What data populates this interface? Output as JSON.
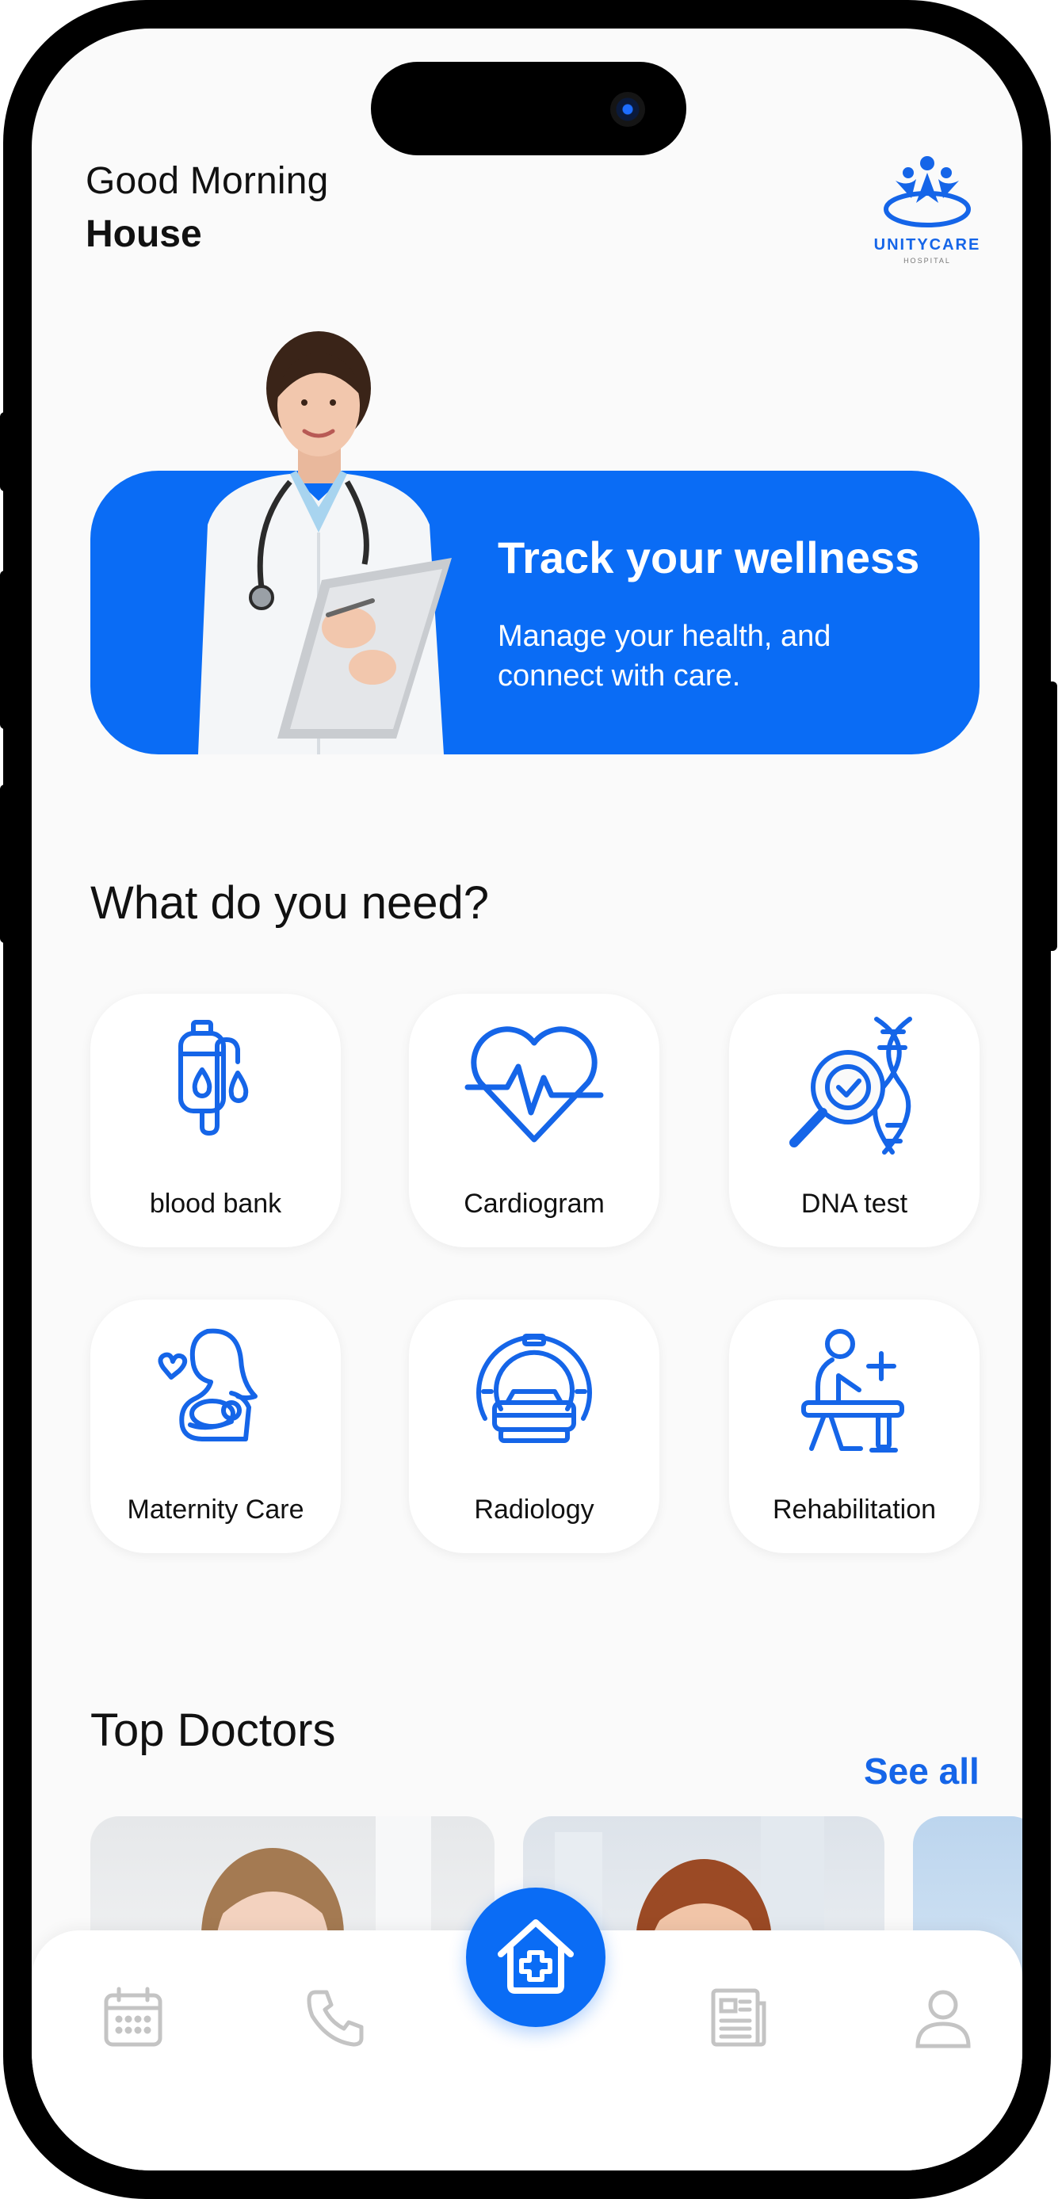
{
  "header": {
    "greeting": "Good Morning",
    "username": "House",
    "logo_name": "UNITYCARE",
    "logo_sub": "HOSPITAL"
  },
  "banner": {
    "title": "Track your wellness",
    "subtitle": "Manage your health, and connect with care."
  },
  "services": {
    "title": "What do you need?",
    "items": [
      {
        "label": "blood bank",
        "icon": "blood-bag-icon"
      },
      {
        "label": "Cardiogram",
        "icon": "heartbeat-icon"
      },
      {
        "label": "DNA test",
        "icon": "dna-magnifier-icon"
      },
      {
        "label": "Maternity Care",
        "icon": "mother-baby-icon"
      },
      {
        "label": "Radiology",
        "icon": "mri-scanner-icon"
      },
      {
        "label": "Rehabilitation",
        "icon": "rehab-icon"
      }
    ]
  },
  "doctors": {
    "title": "Top Doctors",
    "see_all": "See all"
  },
  "nav": {
    "items": [
      "calendar-icon",
      "phone-icon",
      "home-icon",
      "news-icon",
      "profile-icon"
    ],
    "active": "home-icon"
  },
  "colors": {
    "primary": "#0a6cf5",
    "accent_text": "#1565e8",
    "inactive_icon": "#c4c4c4"
  }
}
